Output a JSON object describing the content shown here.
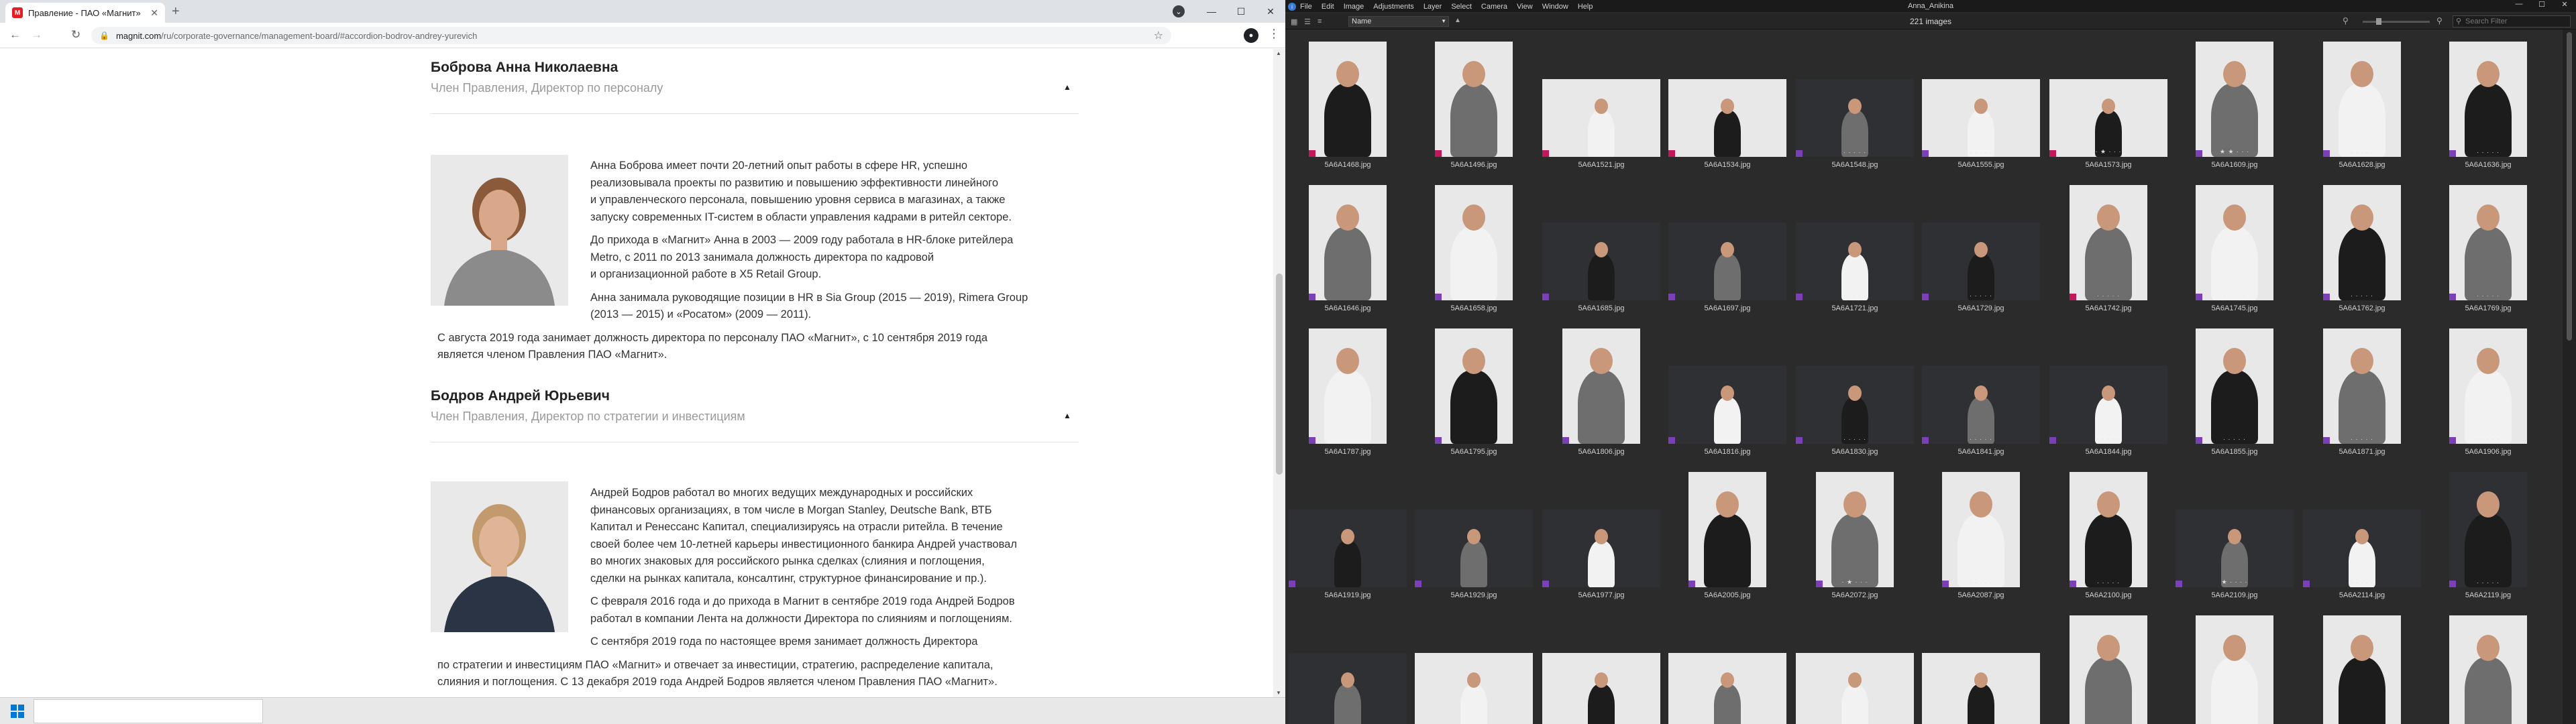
{
  "browser": {
    "tab_title": "Правление - ПАО «Магнит»",
    "url_host": "magnit.com",
    "url_path": "/ru/corporate-governance/management-board/#accordion-bodrov-andrey-yurevich"
  },
  "sections": [
    {
      "name": "Боброва Анна Николаевна",
      "role": "Член Правления, Директор по персоналу",
      "paragraphs_beside_photo": [
        [
          "Анна Боброва имеет почти 20-летний опыт работы в сфере HR, успешно",
          "реализовывала проекты по развитию и повышению эффективности линейного",
          "и управленческого персонала, повышению уровня сервиса в магазинах, а также",
          "запуску современных IT-систем в области управления кадрами в ритейл секторе."
        ],
        [
          "До прихода в «Магнит» Анна в 2003 — 2009 году работала в HR-блоке ритейлера",
          "Metro, с 2011 по 2013 занимала должность директора по кадровой",
          "и организационной работе в X5 Retail Group."
        ],
        [
          "Анна занимала руководящие позиции в HR в Sia Group (2015 — 2019), Rimera Group",
          "(2013 — 2015) и «Росатом» (2009 — 2011)."
        ]
      ],
      "paragraphs_full": [
        [
          "С августа 2019 года занимает должность директора по персоналу ПАО «Магнит», с 10 сентября 2019 года",
          "является членом Правления ПАО «Магнит»."
        ]
      ]
    },
    {
      "name": "Бодров Андрей Юрьевич",
      "role": "Член Правления, Директор по стратегии и инвестициям",
      "paragraphs_beside_photo": [
        [
          "Андрей Бодров работал во многих ведущих международных и российских",
          "финансовых организациях, в том числе в Morgan Stanley, Deutsche Bank, ВТБ",
          "Капитал и Ренессанс Капитал, специализируясь на отрасли ритейла. В течение",
          "своей более чем 10-летней карьеры инвестиционного банкира Андрей участвовал",
          "во многих знаковых для российского рынка сделках (слияния и поглощения,",
          "сделки на рынках капитала, консалтинг, структурное финансирование и пр.)."
        ],
        [
          "С февраля 2016 года и до прихода в Магнит в сентябре 2019 года Андрей Бодров",
          "работал в компании Лента на должности Директора по слияниям и поглощениям."
        ],
        [
          "С сентября 2019 года по настоящее время занимает должность Директора"
        ]
      ],
      "paragraphs_full": [
        [
          "по стратегии и инвестициям ПАО «Магнит» и отвечает за инвестиции, стратегию, распределение капитала,",
          "слияния и поглощения. С 13 декабря 2019 года Андрей Бодров является членом Правления ПАО «Магнит»."
        ]
      ]
    }
  ],
  "viewer": {
    "window_title": "Anna_Anikina",
    "menu": [
      "File",
      "Edit",
      "Image",
      "Adjustments",
      "Layer",
      "Select",
      "Camera",
      "View",
      "Window",
      "Help"
    ],
    "sort_field": "Name",
    "image_count": "221 images",
    "search_placeholder": "Search Filter",
    "colors": {
      "purple": "#7b3fb8",
      "pink": "#c2185b"
    },
    "rows": [
      [
        {
          "name": "5A6A1468.jpg",
          "kind": "p",
          "dark": false,
          "label": "pink",
          "stars": ""
        },
        {
          "name": "5A6A1496.jpg",
          "kind": "p",
          "dark": false,
          "label": "pink",
          "stars": ""
        },
        {
          "name": "5A6A1521.jpg",
          "kind": "l",
          "dark": false,
          "label": "pink",
          "stars": ""
        },
        {
          "name": "5A6A1534.jpg",
          "kind": "l",
          "dark": false,
          "label": "pink",
          "stars": ""
        },
        {
          "name": "5A6A1548.jpg",
          "kind": "l",
          "dark": true,
          "label": "purple",
          "stars": "· · · · ·"
        },
        {
          "name": "5A6A1555.jpg",
          "kind": "l",
          "dark": false,
          "label": "purple",
          "stars": "· · · · ·"
        },
        {
          "name": "5A6A1573.jpg",
          "kind": "l",
          "dark": false,
          "label": "pink",
          "stars": "· ★ · · ·"
        },
        {
          "name": "5A6A1609.jpg",
          "kind": "p",
          "dark": false,
          "label": "purple",
          "stars": "★ ★ · · ·"
        },
        {
          "name": "5A6A1628.jpg",
          "kind": "p",
          "dark": false,
          "label": "purple",
          "stars": "· · · · ·"
        },
        {
          "name": "5A6A1636.jpg",
          "kind": "p",
          "dark": false,
          "label": "purple",
          "stars": "· · · · ·"
        }
      ],
      [
        {
          "name": "5A6A1646.jpg",
          "kind": "p",
          "dark": false,
          "label": "purple",
          "stars": ""
        },
        {
          "name": "5A6A1658.jpg",
          "kind": "p",
          "dark": false,
          "label": "purple",
          "stars": ""
        },
        {
          "name": "5A6A1685.jpg",
          "kind": "l",
          "dark": true,
          "label": "purple",
          "stars": ""
        },
        {
          "name": "5A6A1697.jpg",
          "kind": "l",
          "dark": true,
          "label": "purple",
          "stars": ""
        },
        {
          "name": "5A6A1721.jpg",
          "kind": "l",
          "dark": true,
          "label": "purple",
          "stars": "· · · · ·"
        },
        {
          "name": "5A6A1729.jpg",
          "kind": "l",
          "dark": true,
          "label": "purple",
          "stars": "· · · · ·"
        },
        {
          "name": "5A6A1742.jpg",
          "kind": "p",
          "dark": false,
          "label": "pink",
          "stars": "· · · · ·"
        },
        {
          "name": "5A6A1745.jpg",
          "kind": "p",
          "dark": false,
          "label": "purple",
          "stars": "· · · · ·"
        },
        {
          "name": "5A6A1762.jpg",
          "kind": "p",
          "dark": false,
          "label": "purple",
          "stars": "· · · · ·"
        },
        {
          "name": "5A6A1769.jpg",
          "kind": "p",
          "dark": false,
          "label": "purple",
          "stars": "· · · · ·"
        }
      ],
      [
        {
          "name": "5A6A1787.jpg",
          "kind": "p",
          "dark": false,
          "label": "purple",
          "stars": ""
        },
        {
          "name": "5A6A1795.jpg",
          "kind": "p",
          "dark": false,
          "label": "purple",
          "stars": ""
        },
        {
          "name": "5A6A1806.jpg",
          "kind": "p",
          "dark": false,
          "label": "purple",
          "stars": ""
        },
        {
          "name": "5A6A1816.jpg",
          "kind": "l",
          "dark": true,
          "label": "purple",
          "stars": ""
        },
        {
          "name": "5A6A1830.jpg",
          "kind": "l",
          "dark": true,
          "label": "purple",
          "stars": "· · · · ·"
        },
        {
          "name": "5A6A1841.jpg",
          "kind": "l",
          "dark": true,
          "label": "purple",
          "stars": "· · · · ·"
        },
        {
          "name": "5A6A1844.jpg",
          "kind": "l",
          "dark": true,
          "label": "purple",
          "stars": "· · · · ·"
        },
        {
          "name": "5A6A1855.jpg",
          "kind": "p",
          "dark": false,
          "label": "purple",
          "stars": "· · · · ·"
        },
        {
          "name": "5A6A1871.jpg",
          "kind": "p",
          "dark": false,
          "label": "purple",
          "stars": "· · · · ·"
        },
        {
          "name": "5A6A1906.jpg",
          "kind": "p",
          "dark": false,
          "label": "purple",
          "stars": "· · · · ·"
        }
      ],
      [
        {
          "name": "5A6A1919.jpg",
          "kind": "l",
          "dark": true,
          "label": "purple",
          "stars": ""
        },
        {
          "name": "5A6A1929.jpg",
          "kind": "l",
          "dark": true,
          "label": "purple",
          "stars": ""
        },
        {
          "name": "5A6A1977.jpg",
          "kind": "l",
          "dark": true,
          "label": "purple",
          "stars": ""
        },
        {
          "name": "5A6A2005.jpg",
          "kind": "p",
          "dark": false,
          "label": "purple",
          "stars": ""
        },
        {
          "name": "5A6A2072.jpg",
          "kind": "p",
          "dark": false,
          "label": "purple",
          "stars": "· ★ · · ·"
        },
        {
          "name": "5A6A2087.jpg",
          "kind": "p",
          "dark": false,
          "label": "purple",
          "stars": "· · · · ·"
        },
        {
          "name": "5A6A2100.jpg",
          "kind": "p",
          "dark": false,
          "label": "purple",
          "stars": "· · · · ·"
        },
        {
          "name": "5A6A2109.jpg",
          "kind": "l",
          "dark": true,
          "label": "purple",
          "stars": "★ · · · ·"
        },
        {
          "name": "5A6A2114.jpg",
          "kind": "l",
          "dark": true,
          "label": "purple",
          "stars": "· · · · ·"
        },
        {
          "name": "5A6A2119.jpg",
          "kind": "p",
          "dark": true,
          "label": "purple",
          "stars": "· · · · ·"
        }
      ],
      [
        {
          "name": "",
          "kind": "l",
          "dark": true,
          "label": "",
          "stars": ""
        },
        {
          "name": "",
          "kind": "l",
          "dark": false,
          "label": "",
          "stars": ""
        },
        {
          "name": "",
          "kind": "l",
          "dark": false,
          "label": "",
          "stars": ""
        },
        {
          "name": "",
          "kind": "l",
          "dark": false,
          "label": "",
          "stars": ""
        },
        {
          "name": "",
          "kind": "l",
          "dark": false,
          "label": "",
          "stars": ""
        },
        {
          "name": "",
          "kind": "l",
          "dark": false,
          "label": "",
          "stars": ""
        },
        {
          "name": "",
          "kind": "p",
          "dark": false,
          "label": "",
          "stars": ""
        },
        {
          "name": "",
          "kind": "p",
          "dark": false,
          "label": "",
          "stars": ""
        },
        {
          "name": "",
          "kind": "p",
          "dark": false,
          "label": "",
          "stars": ""
        },
        {
          "name": "",
          "kind": "p",
          "dark": false,
          "label": "",
          "stars": ""
        }
      ]
    ]
  }
}
